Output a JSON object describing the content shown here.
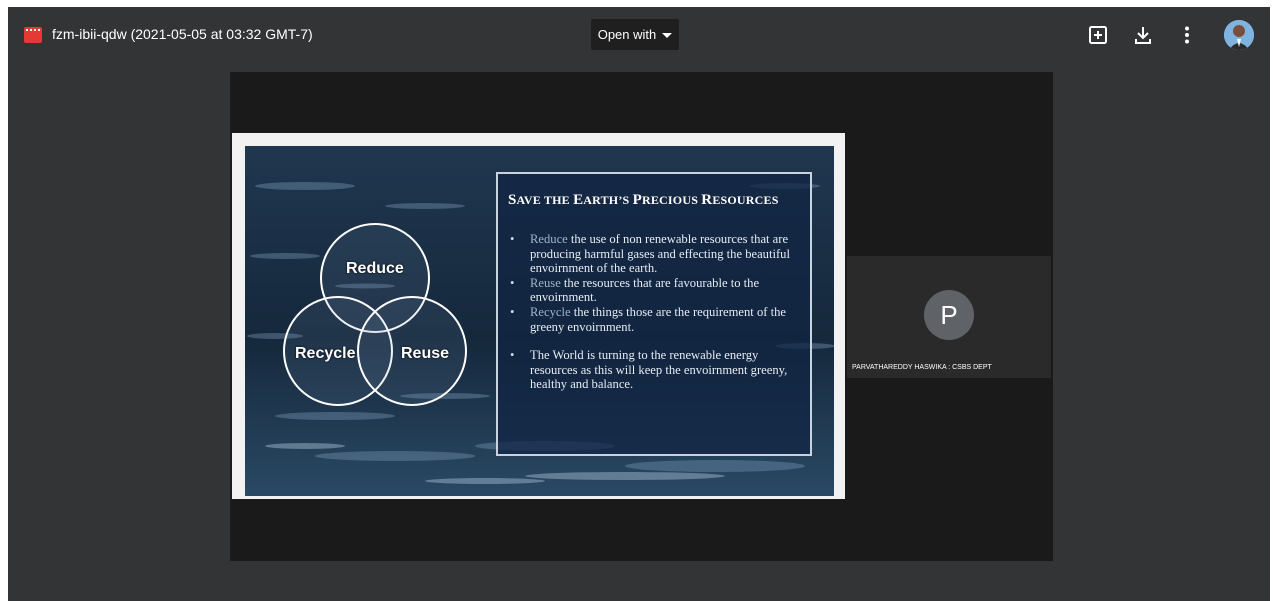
{
  "topbar": {
    "file_icon": "video-file-icon",
    "title": "fzm-ibii-qdw (2021-05-05 at 03:32 GMT-7)",
    "open_with_label": "Open with",
    "icons": [
      "add-to-drive-icon",
      "download-icon",
      "more-vert-icon",
      "account-avatar"
    ]
  },
  "slide": {
    "title": "Save the Earth’s Precious Resources",
    "circles": [
      "Reduce",
      "Recycle",
      "Reuse"
    ],
    "bullets": [
      {
        "highlight": "Reduce",
        "text": " the use of non renewable resources that are producing harmful gases and effecting the beautiful envoirnment of the earth."
      },
      {
        "highlight": "Reuse",
        "text": " the resources that are favourable to the envoirnment."
      },
      {
        "highlight": "Recycle",
        "text": " the things those are the requirement of the greeny envoirnment."
      },
      {
        "highlight": "",
        "text": "The World is turning to the renewable energy resources as this will keep the envoirnment greeny, healthy and balance."
      }
    ]
  },
  "participant": {
    "initial": "P",
    "name": "PARVATHAREDDY HASWIKA : CSBS DEPT"
  },
  "colors": {
    "viewer_bg": "#333436",
    "slide_box": "#102442",
    "accent_red": "#e53935"
  }
}
